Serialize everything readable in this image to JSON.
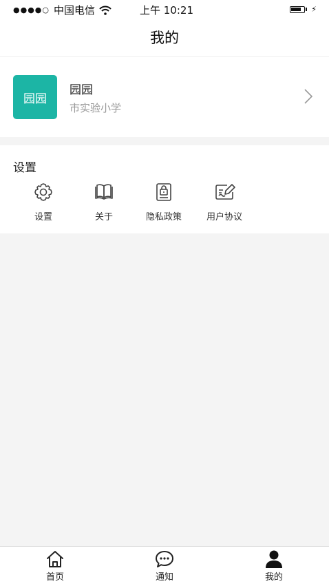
{
  "status_bar": {
    "signal": "●●●●○",
    "carrier": "中国电信",
    "wifi_icon": "wifi-icon",
    "time": "上午 10:21",
    "battery_icon": "battery-icon",
    "charging_icon": "⚡"
  },
  "header": {
    "title": "我的"
  },
  "profile": {
    "avatar_text": "园园",
    "avatar_color": "#1cb5a5",
    "name": "园园",
    "school": "市实验小学",
    "chevron_icon": "chevron-right-icon"
  },
  "settings": {
    "title": "设置",
    "items": [
      {
        "label": "设置",
        "icon": "gear-icon"
      },
      {
        "label": "关于",
        "icon": "book-icon"
      },
      {
        "label": "隐私政策",
        "icon": "lock-document-icon"
      },
      {
        "label": "用户协议",
        "icon": "sign-edit-icon"
      }
    ]
  },
  "tabbar": {
    "tabs": [
      {
        "label": "首页",
        "icon": "home-icon",
        "active": false
      },
      {
        "label": "通知",
        "icon": "chat-bubble-icon",
        "active": false
      },
      {
        "label": "我的",
        "icon": "user-icon",
        "active": true
      }
    ]
  }
}
